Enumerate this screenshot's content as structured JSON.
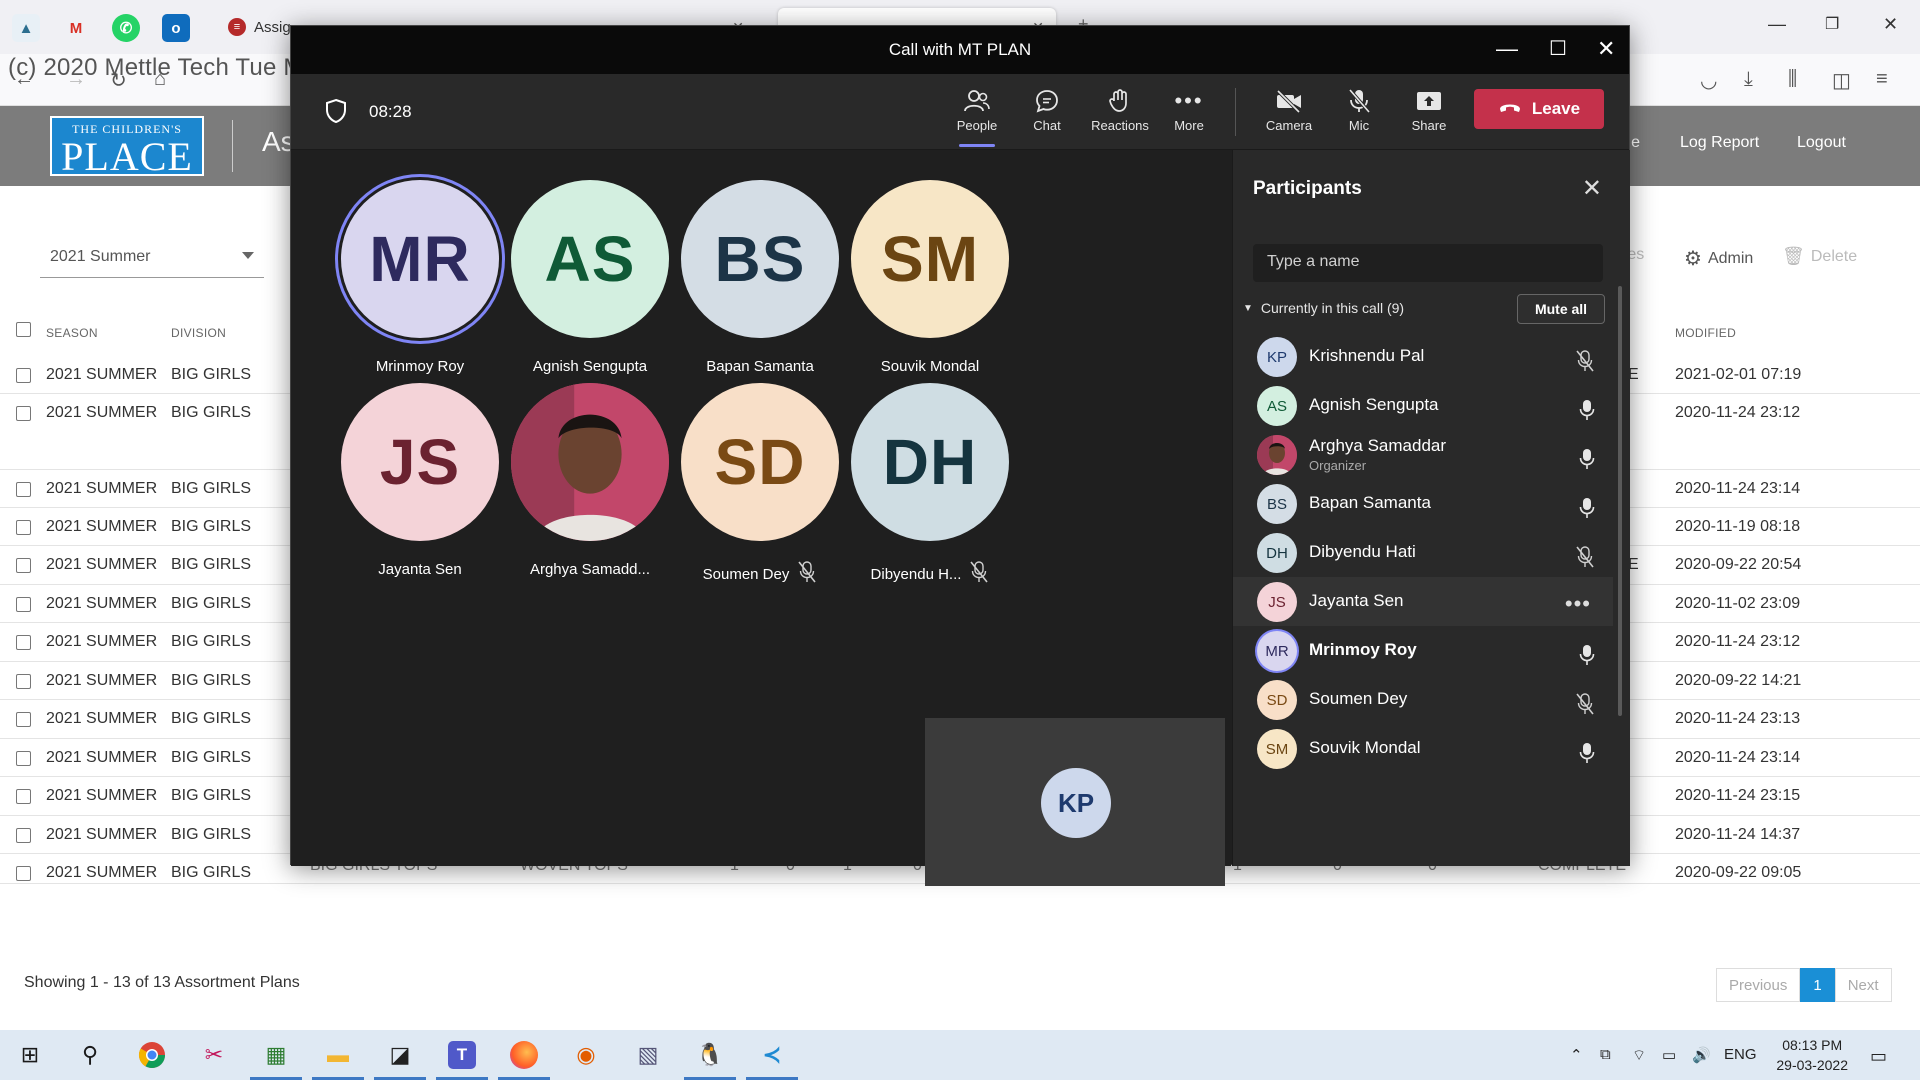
{
  "browser": {
    "tabs": [
      {
        "label": "Assig"
      },
      {
        "label": ""
      }
    ],
    "watermark": "(c) 2020 Mettle Tech Tue Mar 29 20:13:11 IST 2022"
  },
  "app": {
    "logo_line1": "THE CHILDREN'S",
    "logo_line2": "PLACE",
    "title": "As",
    "nav": [
      "ile",
      "Log Report",
      "Logout"
    ],
    "season_select": "2021 Summer",
    "toolbar": {
      "stores": "res",
      "admin": "Admin",
      "delete": "Delete"
    },
    "columns": {
      "season": "SEASON",
      "division": "DIVISION",
      "modified": "MODIFIED"
    },
    "rows": [
      {
        "season": "2021 SUMMER",
        "division": "BIG GIRLS",
        "flag": "E",
        "modified": "2021-02-01 07:19"
      },
      {
        "season": "2021 SUMMER",
        "division": "BIG GIRLS",
        "flag": "",
        "modified": "2020-11-24 23:12"
      },
      {
        "season": "2021 SUMMER",
        "division": "BIG GIRLS",
        "flag": "",
        "modified": "2020-11-24 23:14"
      },
      {
        "season": "2021 SUMMER",
        "division": "BIG GIRLS",
        "flag": "",
        "modified": "2020-11-19 08:18"
      },
      {
        "season": "2021 SUMMER",
        "division": "BIG GIRLS",
        "flag": "E",
        "modified": "2020-09-22 20:54"
      },
      {
        "season": "2021 SUMMER",
        "division": "BIG GIRLS",
        "flag": "",
        "modified": "2020-11-02 23:09"
      },
      {
        "season": "2021 SUMMER",
        "division": "BIG GIRLS",
        "flag": "",
        "modified": "2020-11-24 23:12"
      },
      {
        "season": "2021 SUMMER",
        "division": "BIG GIRLS",
        "flag": "",
        "modified": "2020-09-22 14:21"
      },
      {
        "season": "2021 SUMMER",
        "division": "BIG GIRLS",
        "flag": "",
        "modified": "2020-11-24 23:13"
      },
      {
        "season": "2021 SUMMER",
        "division": "BIG GIRLS",
        "flag": "",
        "modified": "2020-11-24 23:14"
      },
      {
        "season": "2021 SUMMER",
        "division": "BIG GIRLS",
        "flag": "",
        "modified": "2020-11-24 23:15"
      },
      {
        "season": "2021 SUMMER",
        "division": "BIG GIRLS",
        "flag": "",
        "modified": "2020-11-24 14:37"
      },
      {
        "season": "2021 SUMMER",
        "division": "BIG GIRLS",
        "flag": "",
        "modified": "2020-09-22 09:05"
      }
    ],
    "last_row_extra": {
      "department": "BIG GIRLS TOPS",
      "class": "WOVEN TOPS",
      "nums": [
        "1",
        "0",
        "1",
        "0",
        "0",
        "1",
        "0",
        "1",
        "0",
        "0"
      ],
      "status": "COMPLETE"
    },
    "showing": "Showing 1 - 13 of 13 Assortment Plans",
    "pager": {
      "previous": "Previous",
      "current": "1",
      "next": "Next"
    }
  },
  "teams": {
    "window_title": "Call with MT PLAN",
    "timer": "08:28",
    "controls": {
      "people": "People",
      "chat": "Chat",
      "reactions": "Reactions",
      "more": "More",
      "camera": "Camera",
      "mic": "Mic",
      "share": "Share",
      "leave": "Leave"
    },
    "grid": [
      {
        "initials": "MR",
        "name": "Mrinmoy Roy",
        "bg": "#d9d6ef",
        "fg": "#2e2a5e",
        "muted": false,
        "speaking": true,
        "photo": false
      },
      {
        "initials": "AS",
        "name": "Agnish Sengupta",
        "bg": "#d3efe0",
        "fg": "#0f5a36",
        "muted": false,
        "speaking": false,
        "photo": false
      },
      {
        "initials": "BS",
        "name": "Bapan Samanta",
        "bg": "#d4dde5",
        "fg": "#1c3447",
        "muted": false,
        "speaking": false,
        "photo": false
      },
      {
        "initials": "SM",
        "name": "Souvik Mondal",
        "bg": "#f7e6c6",
        "fg": "#6b4512",
        "muted": false,
        "speaking": false,
        "photo": false
      },
      {
        "initials": "JS",
        "name": "Jayanta Sen",
        "bg": "#f4d3d8",
        "fg": "#6b2230",
        "muted": false,
        "speaking": false,
        "photo": false
      },
      {
        "initials": "",
        "name": "Arghya Samadd...",
        "bg": "#b34a68",
        "fg": "#ffffff",
        "muted": false,
        "speaking": false,
        "photo": true
      },
      {
        "initials": "SD",
        "name": "Soumen Dey",
        "bg": "#f8dfc8",
        "fg": "#7a4a14",
        "muted": true,
        "speaking": false,
        "photo": false
      },
      {
        "initials": "DH",
        "name": "Dibyendu H...",
        "bg": "#cfdde3",
        "fg": "#15343f",
        "muted": true,
        "speaking": false,
        "photo": false
      }
    ],
    "self_initials": "KP",
    "participants_panel": {
      "title": "Participants",
      "search_placeholder": "Type a name",
      "in_call_label": "Currently in this call (9)",
      "mute_all": "Mute all",
      "list": [
        {
          "initials": "KP",
          "name": "Krishnendu Pal",
          "role": "",
          "bg": "#cdd8ec",
          "fg": "#1e3a6e",
          "mic": "muted",
          "photo": false,
          "bold": false
        },
        {
          "initials": "AS",
          "name": "Agnish Sengupta",
          "role": "",
          "bg": "#d3efe0",
          "fg": "#0f5a36",
          "mic": "on",
          "photo": false,
          "bold": false
        },
        {
          "initials": "",
          "name": "Arghya Samaddar",
          "role": "Organizer",
          "bg": "#b34a68",
          "fg": "#ffffff",
          "mic": "on",
          "photo": true,
          "bold": false
        },
        {
          "initials": "BS",
          "name": "Bapan Samanta",
          "role": "",
          "bg": "#d4dde5",
          "fg": "#1c3447",
          "mic": "on",
          "photo": false,
          "bold": false
        },
        {
          "initials": "DH",
          "name": "Dibyendu Hati",
          "role": "",
          "bg": "#cfdde3",
          "fg": "#15343f",
          "mic": "muted",
          "photo": false,
          "bold": false
        },
        {
          "initials": "JS",
          "name": "Jayanta Sen",
          "role": "",
          "bg": "#f4d3d8",
          "fg": "#6b2230",
          "mic": "more",
          "photo": false,
          "bold": false
        },
        {
          "initials": "MR",
          "name": "Mrinmoy Roy",
          "role": "",
          "bg": "#d9d6ef",
          "fg": "#2e2a5e",
          "mic": "on",
          "photo": false,
          "bold": true
        },
        {
          "initials": "SD",
          "name": "Soumen Dey",
          "role": "",
          "bg": "#f8dfc8",
          "fg": "#7a4a14",
          "mic": "muted",
          "photo": false,
          "bold": false
        },
        {
          "initials": "SM",
          "name": "Souvik Mondal",
          "role": "",
          "bg": "#f7e6c6",
          "fg": "#6b4512",
          "mic": "on",
          "photo": false,
          "bold": false
        }
      ]
    }
  },
  "taskbar": {
    "lang": "ENG",
    "time": "08:13 PM",
    "date": "29-03-2022"
  }
}
